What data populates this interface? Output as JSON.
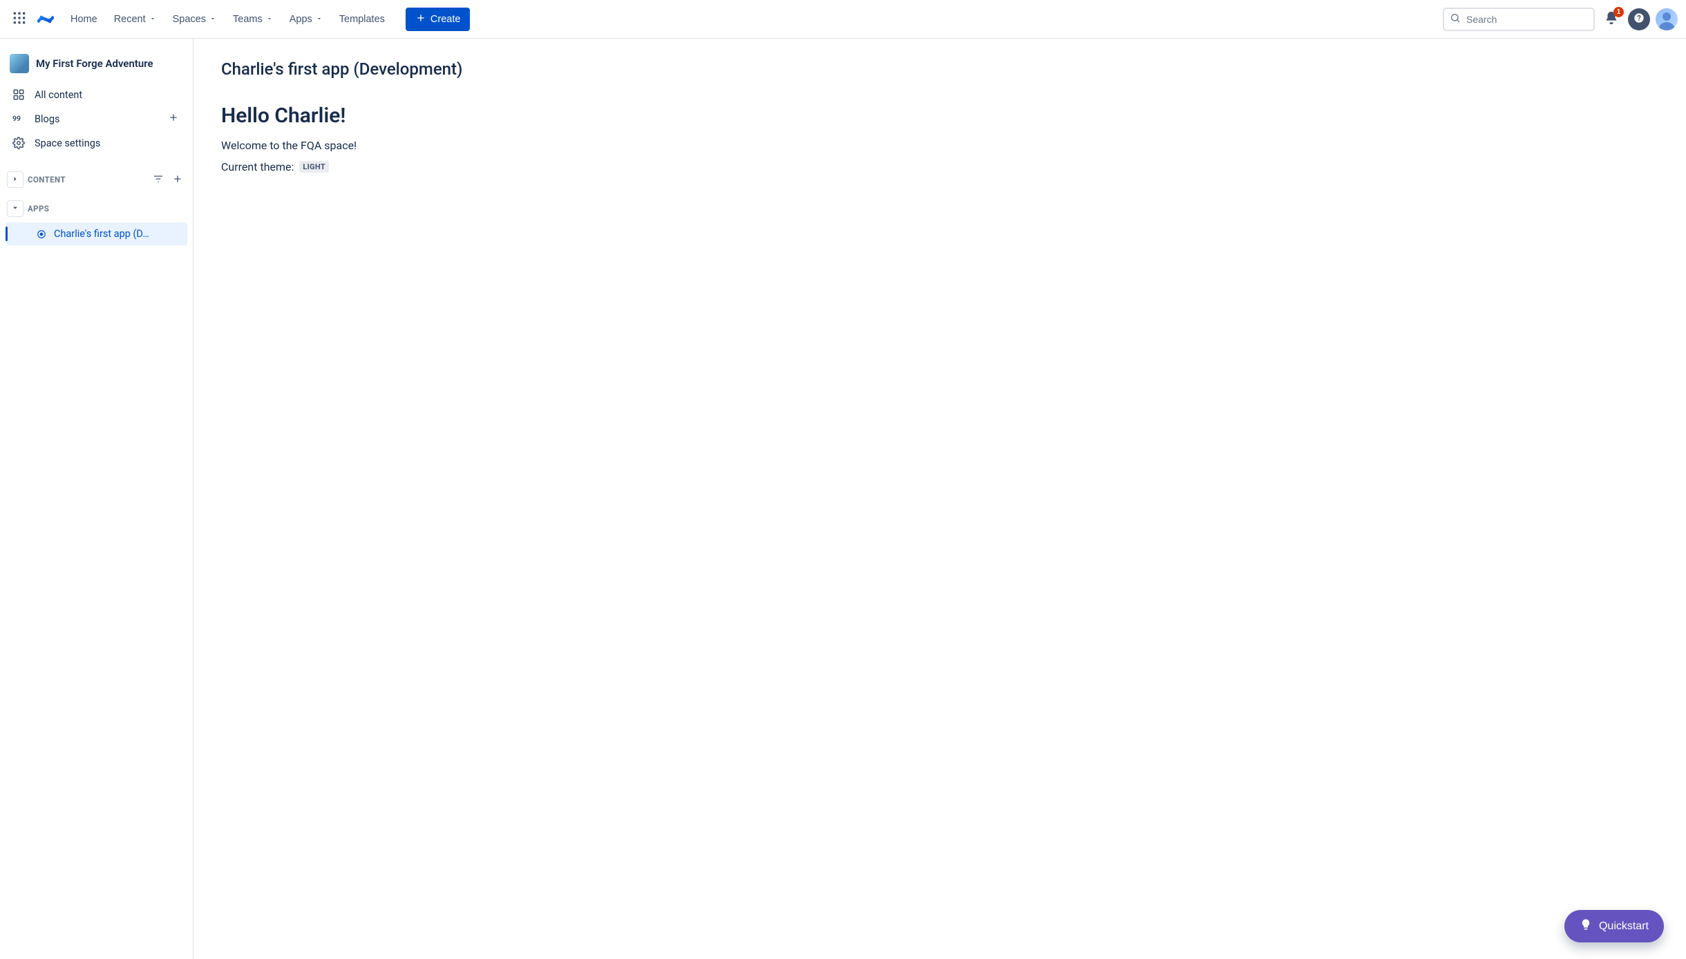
{
  "nav": {
    "home": "Home",
    "recent": "Recent",
    "spaces": "Spaces",
    "teams": "Teams",
    "apps": "Apps",
    "templates": "Templates",
    "create": "Create"
  },
  "search": {
    "placeholder": "Search"
  },
  "notifications": {
    "count": "1"
  },
  "sidebar": {
    "space_name": "My First Forge Adventure",
    "links": {
      "all_content": "All content",
      "blogs": "Blogs",
      "space_settings": "Space settings"
    },
    "sections": {
      "content": "CONTENT",
      "apps": "APPS"
    },
    "apps_items": [
      {
        "label": "Charlie's first app (D…"
      }
    ]
  },
  "page": {
    "title": "Charlie's first app (Development)",
    "heading": "Hello Charlie!",
    "welcome": "Welcome to the FQA space!",
    "theme_label": "Current theme:",
    "theme_value": "LIGHT"
  },
  "quickstart": {
    "label": "Quickstart"
  }
}
